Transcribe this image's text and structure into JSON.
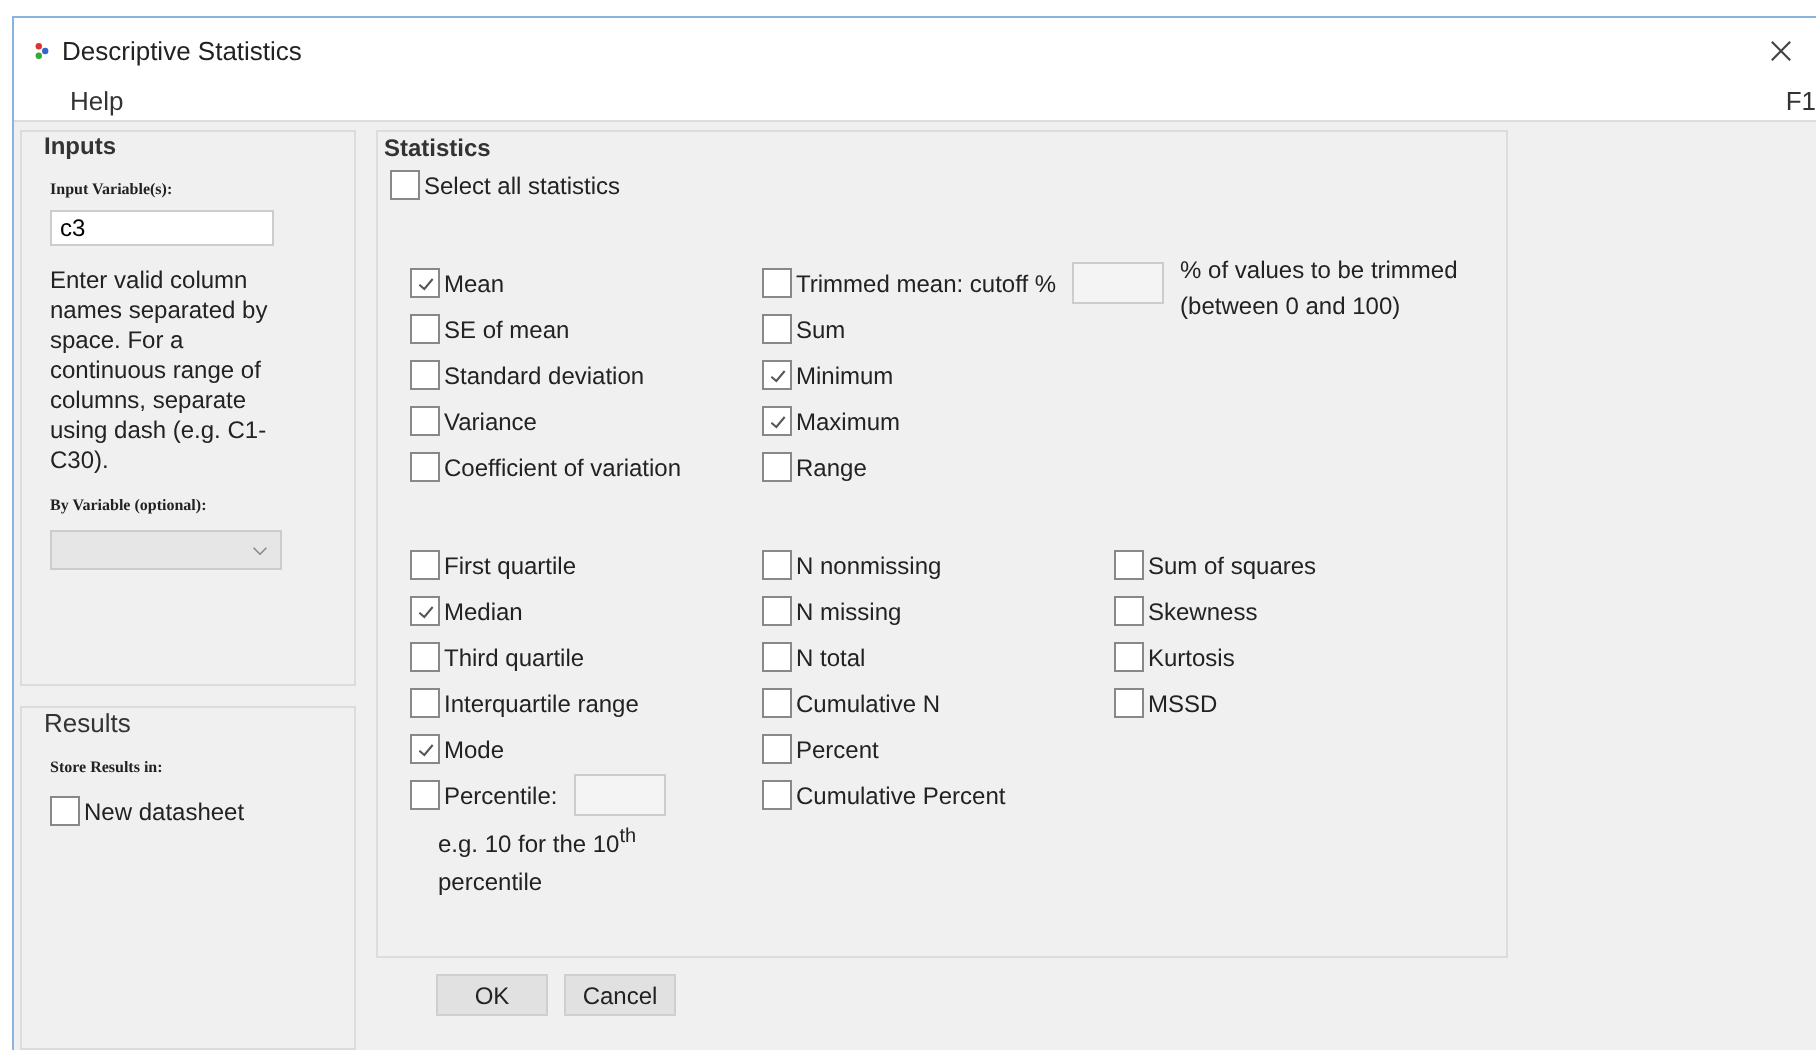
{
  "window": {
    "title": "Descriptive Statistics"
  },
  "menu": [
    {
      "label": "Help"
    }
  ],
  "menu_shortcut": "F1",
  "inputs": {
    "title": "Inputs",
    "input_label": "Input Variable(s):",
    "input_value": "c3",
    "help_text": "Enter valid column names separated by space. For a continuous range of columns, separate using dash (e.g. C1-C30).",
    "by_label": "By Variable (optional):"
  },
  "results": {
    "title": "Results",
    "store_label": "Store Results in:",
    "new_datasheet": {
      "label": "New datasheet",
      "checked": false
    }
  },
  "statistics": {
    "title": "Statistics",
    "select_all": {
      "label": "Select all statistics",
      "checked": false
    },
    "groups": [
      {
        "columns": [
          [
            {
              "kind": "checkbox",
              "label": "Mean",
              "checked": true
            },
            {
              "kind": "checkbox",
              "label": "SE of mean",
              "checked": false
            },
            {
              "kind": "checkbox",
              "label": "Standard deviation",
              "checked": false
            },
            {
              "kind": "checkbox",
              "label": "Variance",
              "checked": false
            },
            {
              "kind": "checkbox",
              "label": "Coefficient of variation",
              "checked": false
            }
          ],
          [
            {
              "kind": "field",
              "label": "Trimmed mean: cutoff %",
              "checked": false,
              "note": "% of values to be trimmed (between 0 and 100)"
            },
            {
              "kind": "checkbox",
              "label": "Sum",
              "checked": false
            },
            {
              "kind": "checkbox",
              "label": "Minimum",
              "checked": true
            },
            {
              "kind": "checkbox",
              "label": "Maximum",
              "checked": true
            },
            {
              "kind": "checkbox",
              "label": "Range",
              "checked": false
            }
          ]
        ]
      },
      {
        "columns": [
          [
            {
              "kind": "checkbox",
              "label": "First quartile",
              "checked": false
            },
            {
              "kind": "checkbox",
              "label": "Median",
              "checked": true
            },
            {
              "kind": "checkbox",
              "label": "Third quartile",
              "checked": false
            },
            {
              "kind": "checkbox",
              "label": "Interquartile range",
              "checked": false
            },
            {
              "kind": "checkbox",
              "label": "Mode",
              "checked": true
            },
            {
              "kind": "field",
              "label": "Percentile:",
              "checked": false,
              "hint": "e.g. 10 for the 10$^{th}$ percentile"
            }
          ],
          [
            {
              "kind": "checkbox",
              "label": "N nonmissing",
              "checked": false
            },
            {
              "kind": "checkbox",
              "label": "N missing",
              "checked": false
            },
            {
              "kind": "checkbox",
              "label": "N total",
              "checked": false
            },
            {
              "kind": "checkbox",
              "label": "Cumulative N",
              "checked": false
            },
            {
              "kind": "checkbox",
              "label": "Percent",
              "checked": false
            },
            {
              "kind": "checkbox",
              "label": "Cumulative Percent",
              "checked": false
            }
          ],
          [
            {
              "kind": "checkbox",
              "label": "Sum of squares",
              "checked": false
            },
            {
              "kind": "checkbox",
              "label": "Skewness",
              "checked": false
            },
            {
              "kind": "checkbox",
              "label": "Kurtosis",
              "checked": false
            },
            {
              "kind": "checkbox",
              "label": "MSSD",
              "checked": false
            }
          ]
        ]
      }
    ]
  },
  "buttons": [
    {
      "label": "OK"
    },
    {
      "label": "Cancel"
    }
  ]
}
